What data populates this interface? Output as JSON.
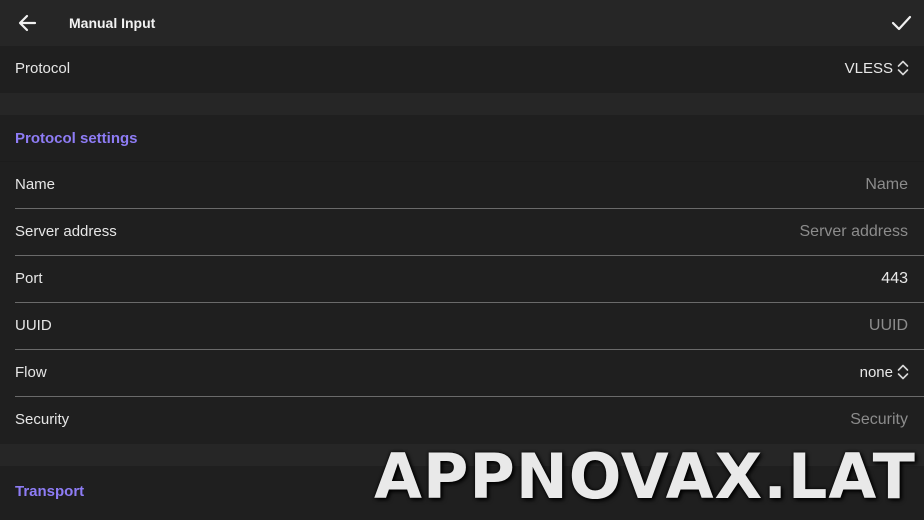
{
  "appbar": {
    "title": "Manual Input"
  },
  "protocol": {
    "label": "Protocol",
    "value": "VLESS"
  },
  "protocol_settings": {
    "header": "Protocol settings",
    "fields": [
      {
        "label": "Name",
        "value": "Name",
        "type": "text"
      },
      {
        "label": "Server address",
        "value": "Server address",
        "type": "text"
      },
      {
        "label": "Port",
        "value": "443",
        "type": "text"
      },
      {
        "label": "UUID",
        "value": "UUID",
        "type": "text"
      },
      {
        "label": "Flow",
        "value": "none",
        "type": "select"
      },
      {
        "label": "Security",
        "value": "Security",
        "type": "text"
      }
    ]
  },
  "transport": {
    "header": "Transport"
  },
  "watermark": "APPNOVAX.LAT"
}
